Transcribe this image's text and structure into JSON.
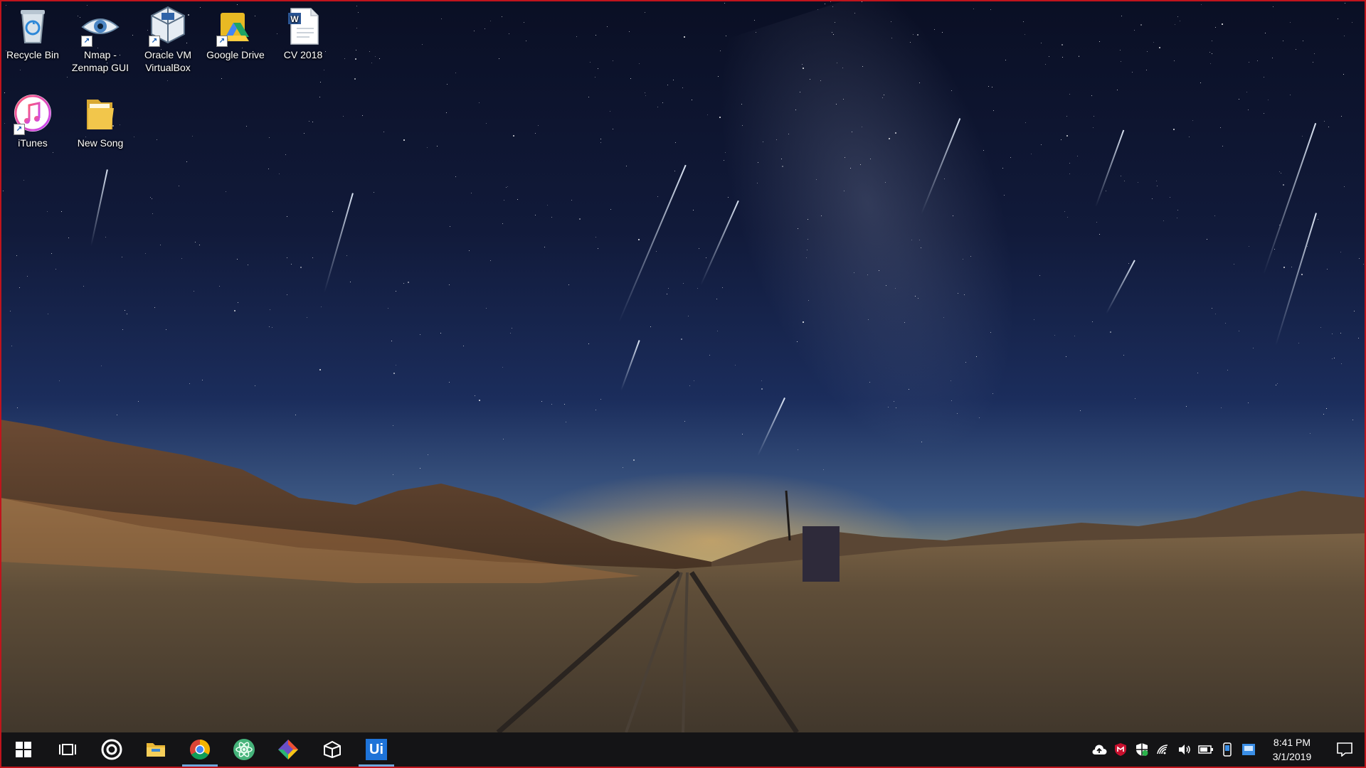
{
  "desktop": {
    "icons": [
      {
        "label": "Recycle Bin",
        "icon": "recycle-bin-icon",
        "shortcut": false
      },
      {
        "label": "Nmap - Zenmap GUI",
        "icon": "nmap-eye-icon",
        "shortcut": true
      },
      {
        "label": "Oracle VM VirtualBox",
        "icon": "virtualbox-icon",
        "shortcut": true
      },
      {
        "label": "Google Drive",
        "icon": "google-drive-icon",
        "shortcut": true
      },
      {
        "label": "CV 2018",
        "icon": "word-document-icon",
        "shortcut": false
      },
      {
        "label": "iTunes",
        "icon": "itunes-icon",
        "shortcut": true
      },
      {
        "label": "New Song",
        "icon": "folder-icon",
        "shortcut": false
      }
    ]
  },
  "taskbar": {
    "pinned": [
      {
        "name": "start-button",
        "icon": "windows-logo-icon"
      },
      {
        "name": "task-view-button",
        "icon": "task-view-icon"
      },
      {
        "name": "cortana-button",
        "icon": "cortana-ring-icon"
      },
      {
        "name": "file-explorer-button",
        "icon": "folder-icon"
      },
      {
        "name": "chrome-button",
        "icon": "chrome-icon",
        "active": true
      },
      {
        "name": "atom-button",
        "icon": "atom-icon"
      },
      {
        "name": "git-button",
        "icon": "git-diamond-icon"
      },
      {
        "name": "unity-button",
        "icon": "unity-icon"
      },
      {
        "name": "uipath-button",
        "icon": "uipath-icon",
        "active": true
      }
    ],
    "tray": {
      "icons": [
        "cloud-upload-icon",
        "mcafee-shield-icon",
        "defender-shield-icon",
        "wifi-icon",
        "volume-icon",
        "battery-icon",
        "device-icon",
        "network-monitor-icon"
      ],
      "time": "8:41 PM",
      "date": "3/1/2019",
      "notification_icon": "action-center-icon"
    }
  },
  "colors": {
    "taskbar_bg": "#141416",
    "frame_border": "#c0141c",
    "active_indicator": "#6fa8dc",
    "uipath_blue": "#1e73d8"
  },
  "labels": {
    "uipath": "Ui"
  }
}
